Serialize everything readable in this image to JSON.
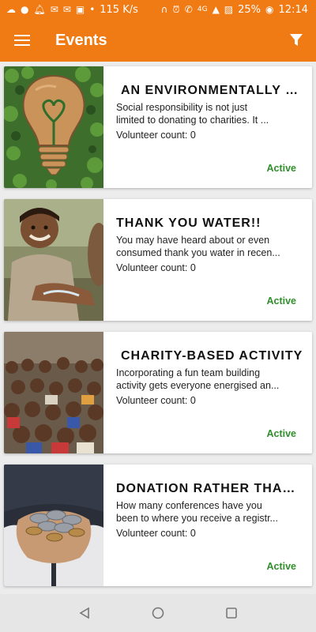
{
  "status_bar": {
    "speed": "115 K/s",
    "network": "4G",
    "battery": "25%",
    "time": "12:14",
    "icons": [
      "cloud-icon",
      "chat-icon",
      "bell-icon",
      "gmail-icon",
      "gmail-icon",
      "photo-icon",
      "ellipsis-icon",
      "headphones-icon",
      "alarm-icon",
      "phone-icon",
      "signal-icon",
      "battery-saver-icon",
      "data-saver-icon"
    ]
  },
  "app_bar": {
    "title": "Events",
    "color": "#f07a14",
    "menu_icon": "hamburger-menu-icon",
    "filter_icon": "filter-icon"
  },
  "events": [
    {
      "title": "AN ENVIRONMENTALLY F...",
      "desc_line1": "Social responsibility is not just",
      "desc_line2": "limited to donating to charities.  It ...",
      "volunteer": "Volunteer count: 0",
      "status": "Active"
    },
    {
      "title": "THANK YOU WATER!!",
      "desc_line1": "You may have heard about or even",
      "desc_line2": "consumed thank you water in recen...",
      "volunteer": "Volunteer count: 0",
      "status": "Active"
    },
    {
      "title": "CHARITY-BASED ACTIVITY",
      "desc_line1": "Incorporating a fun team building",
      "desc_line2": "activity gets everyone energised an...",
      "volunteer": "Volunteer count: 0",
      "status": "Active"
    },
    {
      "title": "DONATION RATHER THAN ...",
      "desc_line1": "How many conferences have you",
      "desc_line2": "been to where you receive a registr...",
      "volunteer": "Volunteer count: 0",
      "status": "Active"
    }
  ],
  "nav_bar": {
    "icons": [
      "back-icon",
      "home-icon",
      "recents-icon"
    ]
  }
}
